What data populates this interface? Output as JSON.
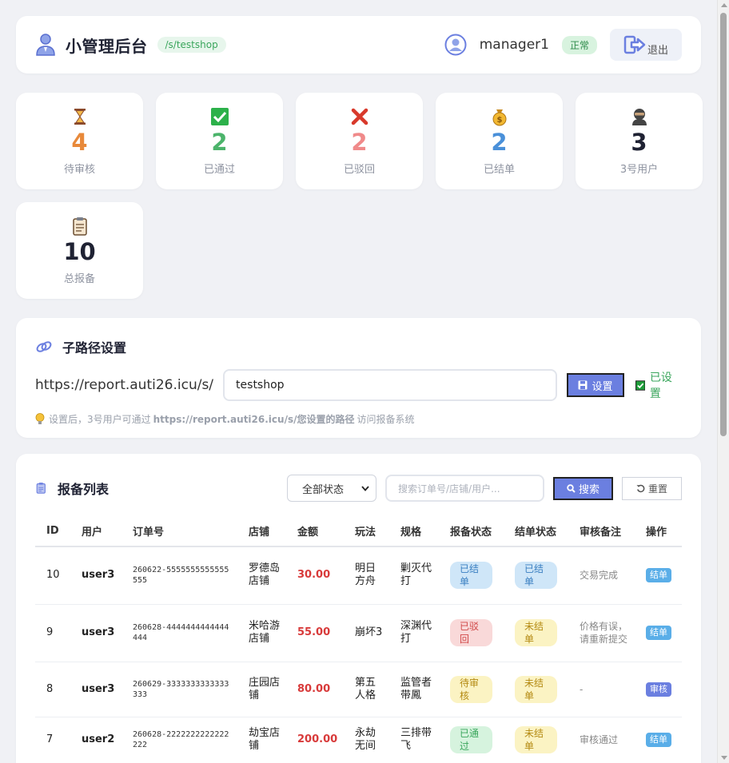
{
  "header": {
    "title": "小管理后台",
    "path_badge": "/s/testshop",
    "username": "manager1",
    "status": "正常",
    "logout_label": "退出"
  },
  "stats": [
    {
      "icon": "hourglass-icon",
      "value": "4",
      "label": "待审核",
      "color": "#e8893a"
    },
    {
      "icon": "check-icon",
      "value": "2",
      "label": "已通过",
      "color": "#4cb46b"
    },
    {
      "icon": "cross-icon",
      "value": "2",
      "label": "已驳回",
      "color": "#f08a8a"
    },
    {
      "icon": "money-bag-icon",
      "value": "2",
      "label": "已结单",
      "color": "#4a90d9"
    },
    {
      "icon": "ninja-icon",
      "value": "3",
      "label": "3号用户",
      "color": "#1f2233"
    },
    {
      "icon": "clipboard-icon",
      "value": "10",
      "label": "总报备",
      "color": "#1f2233"
    }
  ],
  "subpath": {
    "title": "子路径设置",
    "prefix": "https://report.auti26.icu/s/",
    "value": "testshop",
    "set_label": "设置",
    "done_label": "已设置",
    "tip_before": "设置后，3号用户可通过",
    "tip_bold": "https://report.auti26.icu/s/您设置的路径",
    "tip_after": "访问报备系统"
  },
  "list": {
    "title": "报备列表",
    "status_filter": "全部状态",
    "search_placeholder": "搜索订单号/店铺/用户...",
    "search_label": "搜索",
    "reset_label": "重置",
    "columns": [
      "ID",
      "用户",
      "订单号",
      "店铺",
      "金额",
      "玩法",
      "规格",
      "报备状态",
      "结单状态",
      "审核备注",
      "操作"
    ],
    "rows": [
      {
        "id": "10",
        "user": "user3",
        "order": "260622-5555555555555555",
        "shop": "罗德岛店铺",
        "amount": "30.00",
        "play": "明日方舟",
        "spec": "剿灭代打",
        "report_status": "已结单",
        "close_status": "已结单",
        "note": "交易完成",
        "action": "结单"
      },
      {
        "id": "9",
        "user": "user3",
        "order": "260628-4444444444444444",
        "shop": "米哈游店铺",
        "amount": "55.00",
        "play": "崩坏3",
        "spec": "深渊代打",
        "report_status": "已驳回",
        "close_status": "未结单",
        "note": "价格有误，请重新提交",
        "action": "结单"
      },
      {
        "id": "8",
        "user": "user3",
        "order": "260629-3333333333333333",
        "shop": "庄园店铺",
        "amount": "80.00",
        "play": "第五人格",
        "spec": "监管者 带鳳",
        "report_status": "待审核",
        "close_status": "未结单",
        "note": "-",
        "action": "审核"
      },
      {
        "id": "7",
        "user": "user2",
        "order": "260628-2222222222222222",
        "shop": "劫宝店铺",
        "amount": "200.00",
        "play": "永劫无间",
        "spec": "三排带飞",
        "report_status": "已通过",
        "close_status": "未结单",
        "note": "审核通过",
        "action": "结单"
      }
    ]
  }
}
